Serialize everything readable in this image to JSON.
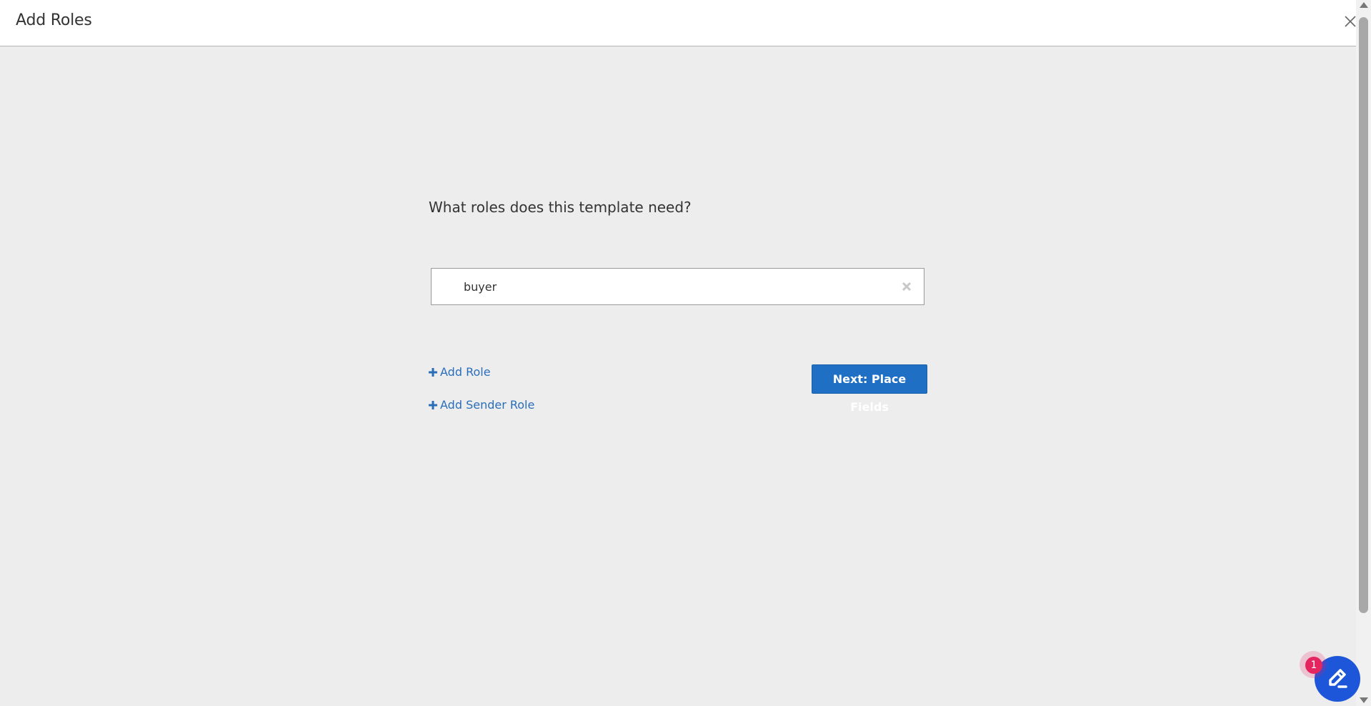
{
  "header": {
    "title": "Add Roles"
  },
  "main": {
    "question": "What roles does this template need?",
    "role_input_value": "buyer",
    "add_role_label": "Add Role",
    "add_sender_role_label": "Add Sender Role",
    "next_button_label": "Next: Place Fields"
  },
  "fab": {
    "badge_count": "1",
    "icon": "edit-pen-icon"
  },
  "colors": {
    "link": "#2a6ebb",
    "primary_button": "#1f6fc5",
    "background": "#ededed",
    "fab": "#1d56d8",
    "badge": "#e5255f"
  }
}
